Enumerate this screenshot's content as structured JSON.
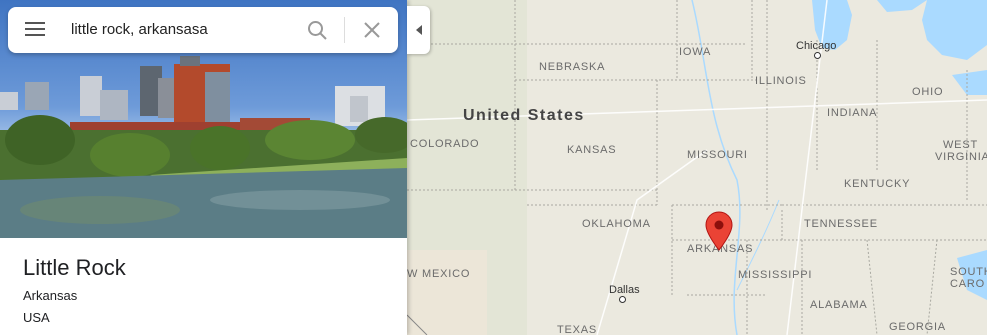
{
  "search": {
    "query": "little rock, arkansasa"
  },
  "place": {
    "name": "Little Rock",
    "region": "Arkansas",
    "country": "USA"
  },
  "map": {
    "country_label": "United States",
    "states": {
      "iowa": "IOWA",
      "nebraska": "NEBRASKA",
      "illinois": "ILLINOIS",
      "indiana": "INDIANA",
      "ohio": "OHIO",
      "colorado": "COLORADO",
      "kansas": "KANSAS",
      "missouri": "MISSOURI",
      "west_virginia_1": "WEST",
      "west_virginia_2": "VIRGINIA",
      "kentucky": "KENTUCKY",
      "oklahoma": "OKLAHOMA",
      "arkansas": "ARKANSAS",
      "tennessee": "TENNESSEE",
      "new_mexico": "W MEXICO",
      "mississippi": "MISSISSIPPI",
      "south_1": "SOUTH",
      "south_2": "CARO",
      "alabama": "ALABAMA",
      "georgia": "GEORGIA",
      "texas": "TEXAS"
    },
    "cities": {
      "chicago": "Chicago",
      "dallas": "Dallas"
    },
    "colors": {
      "marker": "#ea4335",
      "water": "#aadaff",
      "land": "#ebe9df"
    }
  }
}
